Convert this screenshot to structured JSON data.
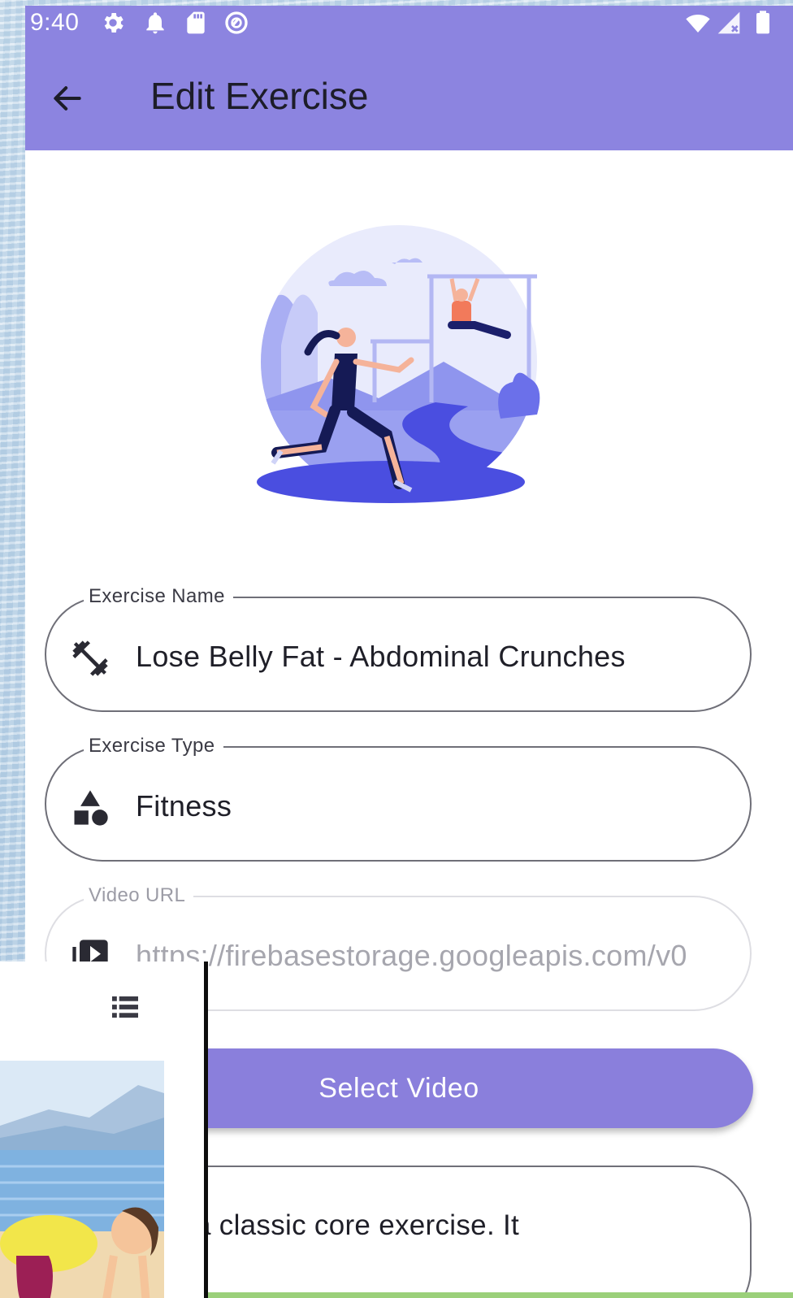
{
  "status_bar": {
    "time": "9:40",
    "left_icons": [
      "gear-icon",
      "bell-icon",
      "sd-card-icon",
      "sync-icon"
    ],
    "right_icons": [
      "wifi-icon",
      "signal-icon",
      "battery-icon"
    ]
  },
  "app_bar": {
    "title": "Edit Exercise",
    "back_icon": "arrow-back-icon",
    "color": "#8c84e0"
  },
  "form": {
    "exercise_name": {
      "label": "Exercise Name",
      "value": "Lose Belly Fat - Abdominal Crunches",
      "icon": "dumbbell-icon"
    },
    "exercise_type": {
      "label": "Exercise Type",
      "value": "Fitness",
      "icon": "category-shapes-icon"
    },
    "video_url": {
      "label": "Video URL",
      "value": "https://firebasestorage.googleapis.com/v0",
      "icon": "video-library-icon",
      "enabled": false
    },
    "select_video_label": "Select Video",
    "description_visible_text": "runch is a classic core exercise. It"
  },
  "overlay_window": {
    "icon": "list-icon"
  },
  "colors": {
    "accent": "#8a7fdc",
    "illustration_primary": "#4a4ee0",
    "illustration_light": "#c9cdf8"
  }
}
